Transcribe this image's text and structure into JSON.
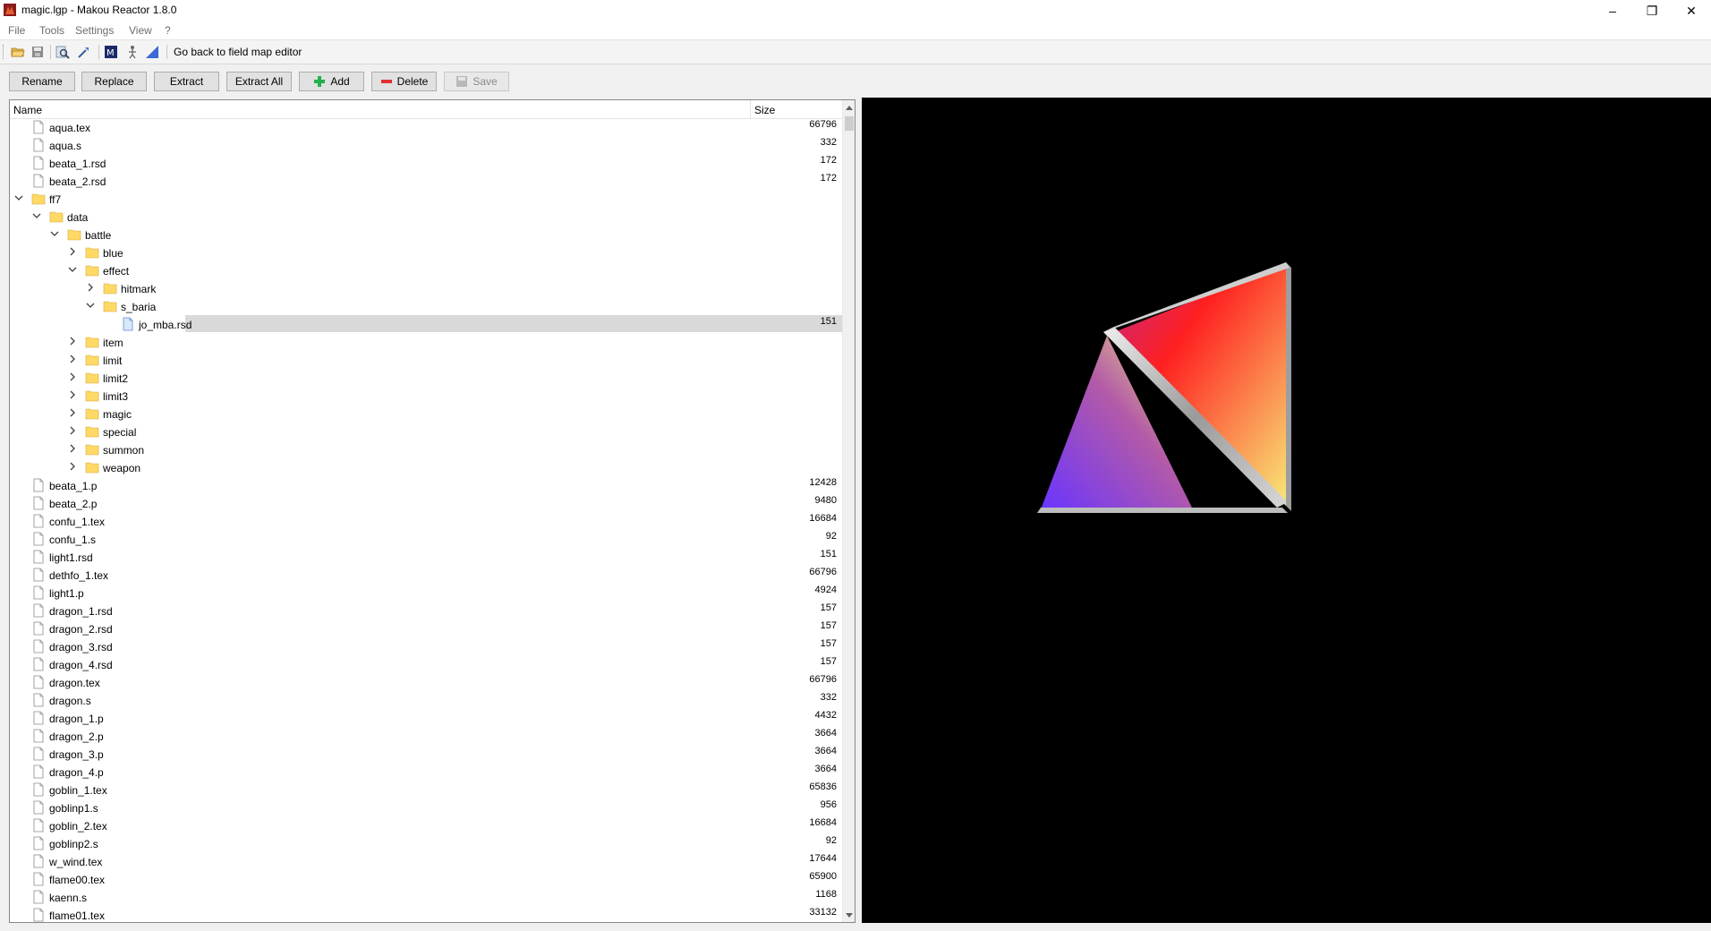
{
  "window": {
    "title": "magic.lgp - Makou Reactor 1.8.0",
    "controls": {
      "minimize": "–",
      "maximize": "❐",
      "close": "✕"
    }
  },
  "menu": {
    "items": [
      "File",
      "Tools",
      "Settings",
      "View",
      "?"
    ]
  },
  "toolbar": {
    "back_label": "Go back to field map editor"
  },
  "actions": {
    "rename": "Rename",
    "replace": "Replace",
    "extract": "Extract",
    "extract_all": "Extract All",
    "add": "Add",
    "delete": "Delete",
    "save": "Save"
  },
  "tree": {
    "columns": {
      "name": "Name",
      "size": "Size"
    },
    "rows": [
      {
        "depth": 0,
        "type": "file",
        "label": "aqua.tex",
        "size": "66796"
      },
      {
        "depth": 0,
        "type": "file",
        "label": "aqua.s",
        "size": "332"
      },
      {
        "depth": 0,
        "type": "file",
        "label": "beata_1.rsd",
        "size": "172"
      },
      {
        "depth": 0,
        "type": "file",
        "label": "beata_2.rsd",
        "size": "172"
      },
      {
        "depth": 0,
        "type": "folder",
        "expanded": true,
        "label": "ff7",
        "size": ""
      },
      {
        "depth": 1,
        "type": "folder",
        "expanded": true,
        "label": "data",
        "size": ""
      },
      {
        "depth": 2,
        "type": "folder",
        "expanded": true,
        "label": "battle",
        "size": ""
      },
      {
        "depth": 3,
        "type": "folder",
        "expanded": false,
        "label": "blue",
        "size": ""
      },
      {
        "depth": 3,
        "type": "folder",
        "expanded": true,
        "label": "effect",
        "size": ""
      },
      {
        "depth": 4,
        "type": "folder",
        "expanded": false,
        "label": "hitmark",
        "size": ""
      },
      {
        "depth": 4,
        "type": "folder",
        "expanded": true,
        "label": "s_baria",
        "size": ""
      },
      {
        "depth": 5,
        "type": "file",
        "selected": true,
        "label": "jo_mba.rsd",
        "size": "151"
      },
      {
        "depth": 3,
        "type": "folder",
        "expanded": false,
        "label": "item",
        "size": ""
      },
      {
        "depth": 3,
        "type": "folder",
        "expanded": false,
        "label": "limit",
        "size": ""
      },
      {
        "depth": 3,
        "type": "folder",
        "expanded": false,
        "label": "limit2",
        "size": ""
      },
      {
        "depth": 3,
        "type": "folder",
        "expanded": false,
        "label": "limit3",
        "size": ""
      },
      {
        "depth": 3,
        "type": "folder",
        "expanded": false,
        "label": "magic",
        "size": ""
      },
      {
        "depth": 3,
        "type": "folder",
        "expanded": false,
        "label": "special",
        "size": ""
      },
      {
        "depth": 3,
        "type": "folder",
        "expanded": false,
        "label": "summon",
        "size": ""
      },
      {
        "depth": 3,
        "type": "folder",
        "expanded": false,
        "label": "weapon",
        "size": ""
      },
      {
        "depth": 0,
        "type": "file",
        "label": "beata_1.p",
        "size": "12428"
      },
      {
        "depth": 0,
        "type": "file",
        "label": "beata_2.p",
        "size": "9480"
      },
      {
        "depth": 0,
        "type": "file",
        "label": "confu_1.tex",
        "size": "16684"
      },
      {
        "depth": 0,
        "type": "file",
        "label": "confu_1.s",
        "size": "92"
      },
      {
        "depth": 0,
        "type": "file",
        "label": "light1.rsd",
        "size": "151"
      },
      {
        "depth": 0,
        "type": "file",
        "label": "dethfo_1.tex",
        "size": "66796"
      },
      {
        "depth": 0,
        "type": "file",
        "label": "light1.p",
        "size": "4924"
      },
      {
        "depth": 0,
        "type": "file",
        "label": "dragon_1.rsd",
        "size": "157"
      },
      {
        "depth": 0,
        "type": "file",
        "label": "dragon_2.rsd",
        "size": "157"
      },
      {
        "depth": 0,
        "type": "file",
        "label": "dragon_3.rsd",
        "size": "157"
      },
      {
        "depth": 0,
        "type": "file",
        "label": "dragon_4.rsd",
        "size": "157"
      },
      {
        "depth": 0,
        "type": "file",
        "label": "dragon.tex",
        "size": "66796"
      },
      {
        "depth": 0,
        "type": "file",
        "label": "dragon.s",
        "size": "332"
      },
      {
        "depth": 0,
        "type": "file",
        "label": "dragon_1.p",
        "size": "4432"
      },
      {
        "depth": 0,
        "type": "file",
        "label": "dragon_2.p",
        "size": "3664"
      },
      {
        "depth": 0,
        "type": "file",
        "label": "dragon_3.p",
        "size": "3664"
      },
      {
        "depth": 0,
        "type": "file",
        "label": "dragon_4.p",
        "size": "3664"
      },
      {
        "depth": 0,
        "type": "file",
        "label": "goblin_1.tex",
        "size": "65836"
      },
      {
        "depth": 0,
        "type": "file",
        "label": "goblinp1.s",
        "size": "956"
      },
      {
        "depth": 0,
        "type": "file",
        "label": "goblin_2.tex",
        "size": "16684"
      },
      {
        "depth": 0,
        "type": "file",
        "label": "goblinp2.s",
        "size": "92"
      },
      {
        "depth": 0,
        "type": "file",
        "label": "w_wind.tex",
        "size": "17644"
      },
      {
        "depth": 0,
        "type": "file",
        "label": "flame00.tex",
        "size": "65900"
      },
      {
        "depth": 0,
        "type": "file",
        "label": "kaenn.s",
        "size": "1168"
      },
      {
        "depth": 0,
        "type": "file",
        "label": "flame01.tex",
        "size": "33132"
      }
    ]
  },
  "colors": {
    "folder": "#ffd966",
    "selection": "#d9d9d9",
    "preview_bg": "#000000",
    "add_icon": "#22b14c",
    "delete_icon": "#e03030"
  }
}
